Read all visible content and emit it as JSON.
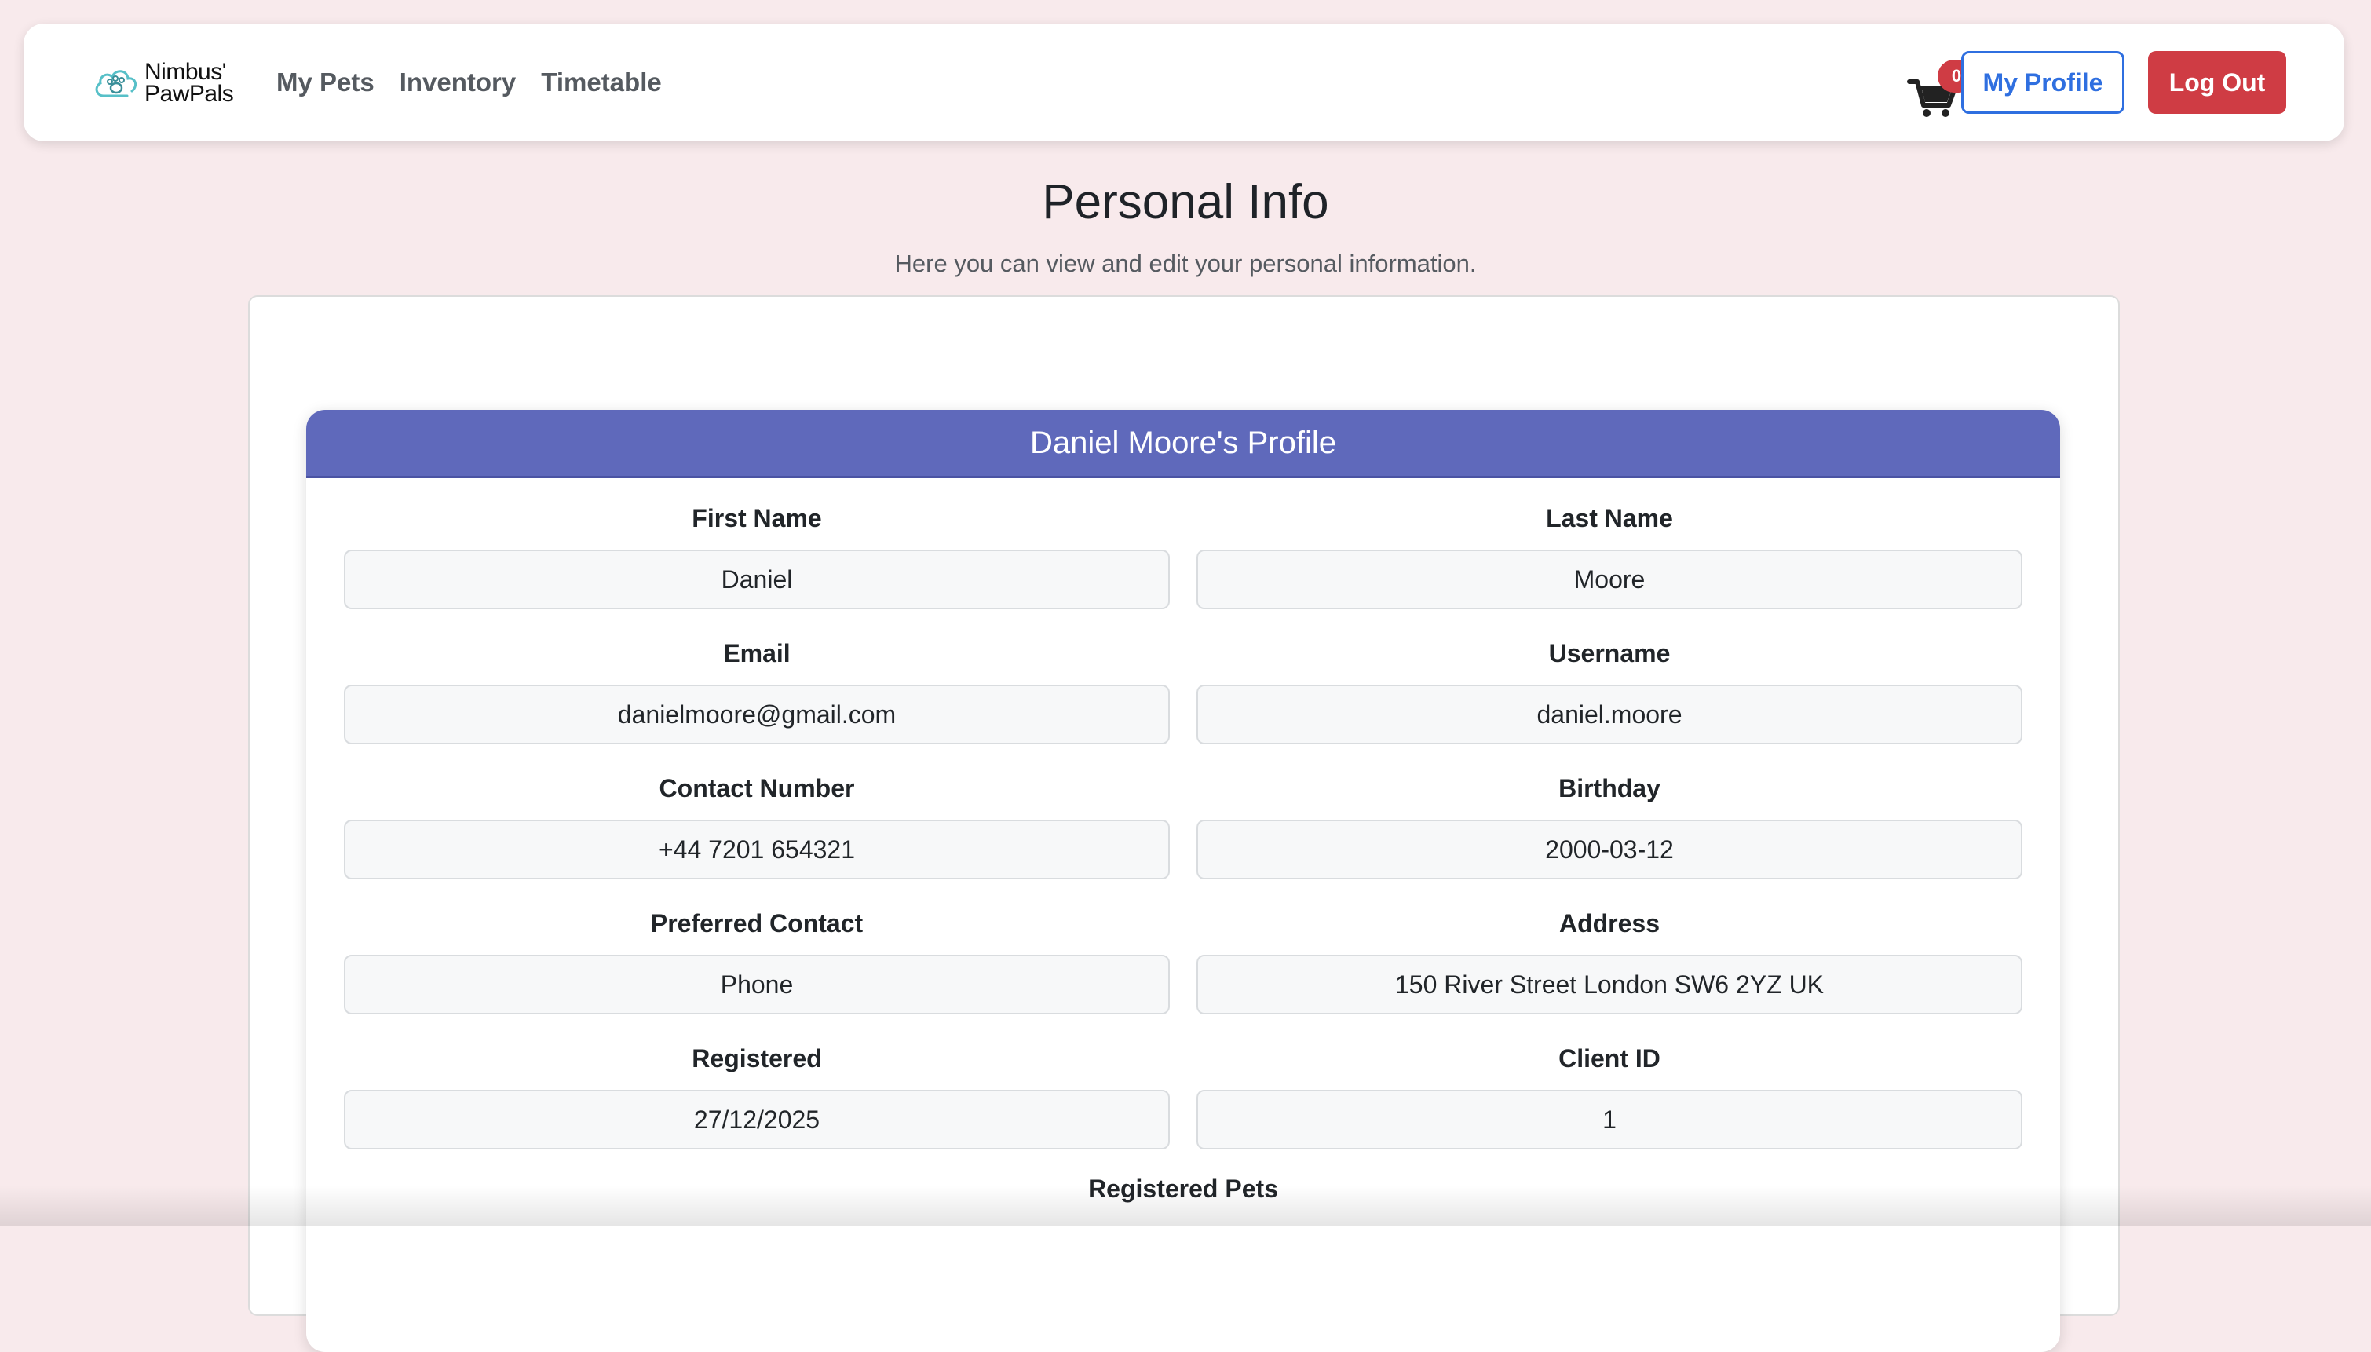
{
  "brand": {
    "name_line1": "Nimbus'",
    "name_line2": "PawPals",
    "accent_color": "#57c0c8"
  },
  "nav": {
    "links": [
      "My Pets",
      "Inventory",
      "Timetable"
    ],
    "cart_count": "0",
    "cart_icon": "shopping-cart-icon",
    "profile_label": "My Profile",
    "logout_label": "Log Out"
  },
  "page": {
    "title": "Personal Info",
    "subtitle": "Here you can view and edit your personal information."
  },
  "profile": {
    "header": "Daniel Moore's Profile",
    "header_color": "#5f69bb",
    "fields": [
      {
        "label": "First Name",
        "value": "Daniel"
      },
      {
        "label": "Last Name",
        "value": "Moore"
      },
      {
        "label": "Email",
        "value": "danielmoore@gmail.com"
      },
      {
        "label": "Username",
        "value": "daniel.moore"
      },
      {
        "label": "Contact Number",
        "value": "+44 7201 654321"
      },
      {
        "label": "Birthday",
        "value": "2000-03-12"
      },
      {
        "label": "Preferred Contact",
        "value": "Phone"
      },
      {
        "label": "Address",
        "value": "150 River Street London SW6 2YZ UK"
      },
      {
        "label": "Registered",
        "value": "27/12/2025"
      },
      {
        "label": "Client ID",
        "value": "1"
      }
    ],
    "pets_heading": "Registered Pets"
  },
  "colors": {
    "page_background": "#f8eaec",
    "logout_button": "#cf3c44",
    "profile_button": "#2f6fe0"
  }
}
